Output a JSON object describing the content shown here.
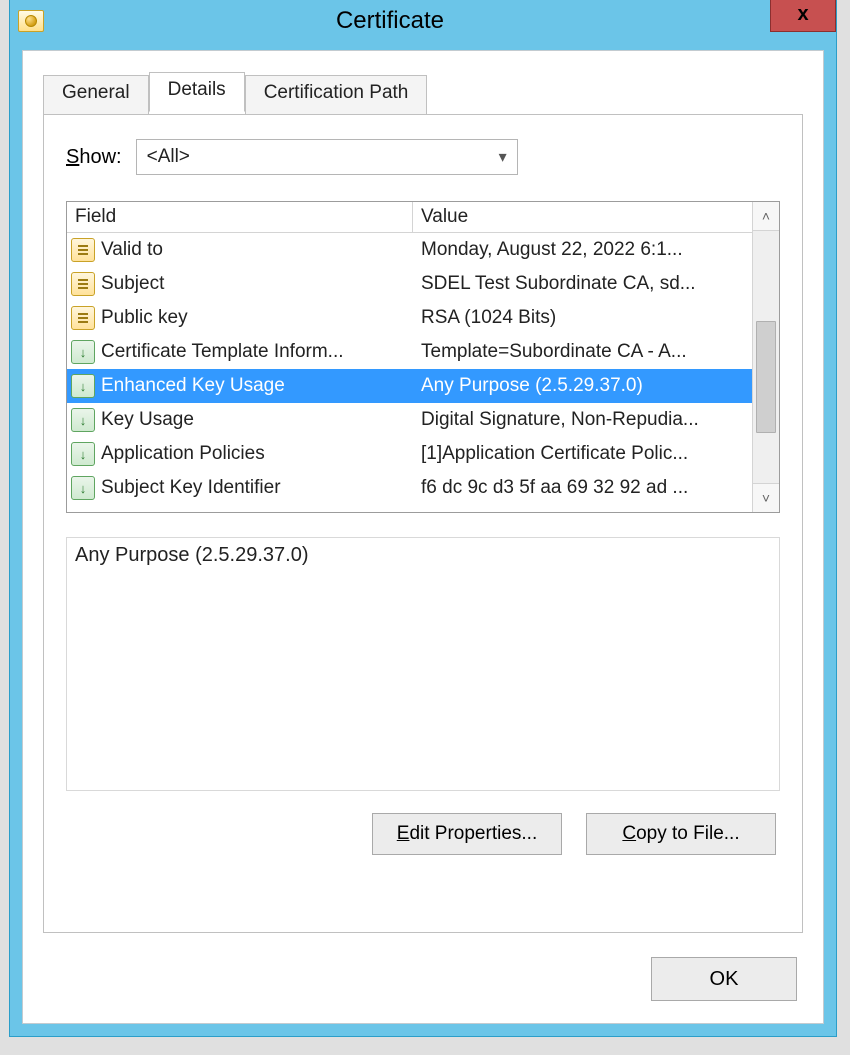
{
  "window": {
    "title": "Certificate"
  },
  "tabs": {
    "general": "General",
    "details": "Details",
    "certpath": "Certification Path",
    "selected": "details"
  },
  "show": {
    "label_prefix": "S",
    "label_rest": "how:",
    "value": "<All>"
  },
  "columns": {
    "field": "Field",
    "value": "Value"
  },
  "rows": [
    {
      "icon": "v1",
      "field": "Valid to",
      "value": "Monday, August 22, 2022 6:1..."
    },
    {
      "icon": "v1",
      "field": "Subject",
      "value": "SDEL Test Subordinate CA, sd..."
    },
    {
      "icon": "v1",
      "field": "Public key",
      "value": "RSA (1024 Bits)"
    },
    {
      "icon": "v2",
      "field": "Certificate Template Inform...",
      "value": "Template=Subordinate CA - A..."
    },
    {
      "icon": "v2",
      "field": "Enhanced Key Usage",
      "value": "Any Purpose (2.5.29.37.0)",
      "selected": true
    },
    {
      "icon": "v2",
      "field": "Key Usage",
      "value": "Digital Signature, Non-Repudia..."
    },
    {
      "icon": "v2",
      "field": "Application Policies",
      "value": "[1]Application Certificate Polic..."
    },
    {
      "icon": "v2",
      "field": "Subject Key Identifier",
      "value": "f6 dc 9c d3 5f aa 69 32 92 ad ..."
    }
  ],
  "detail_text": "Any Purpose (2.5.29.37.0)",
  "buttons": {
    "edit_prefix": "E",
    "edit_rest": "dit Properties...",
    "copy_prefix": "C",
    "copy_rest": "opy to File...",
    "ok": "OK"
  }
}
